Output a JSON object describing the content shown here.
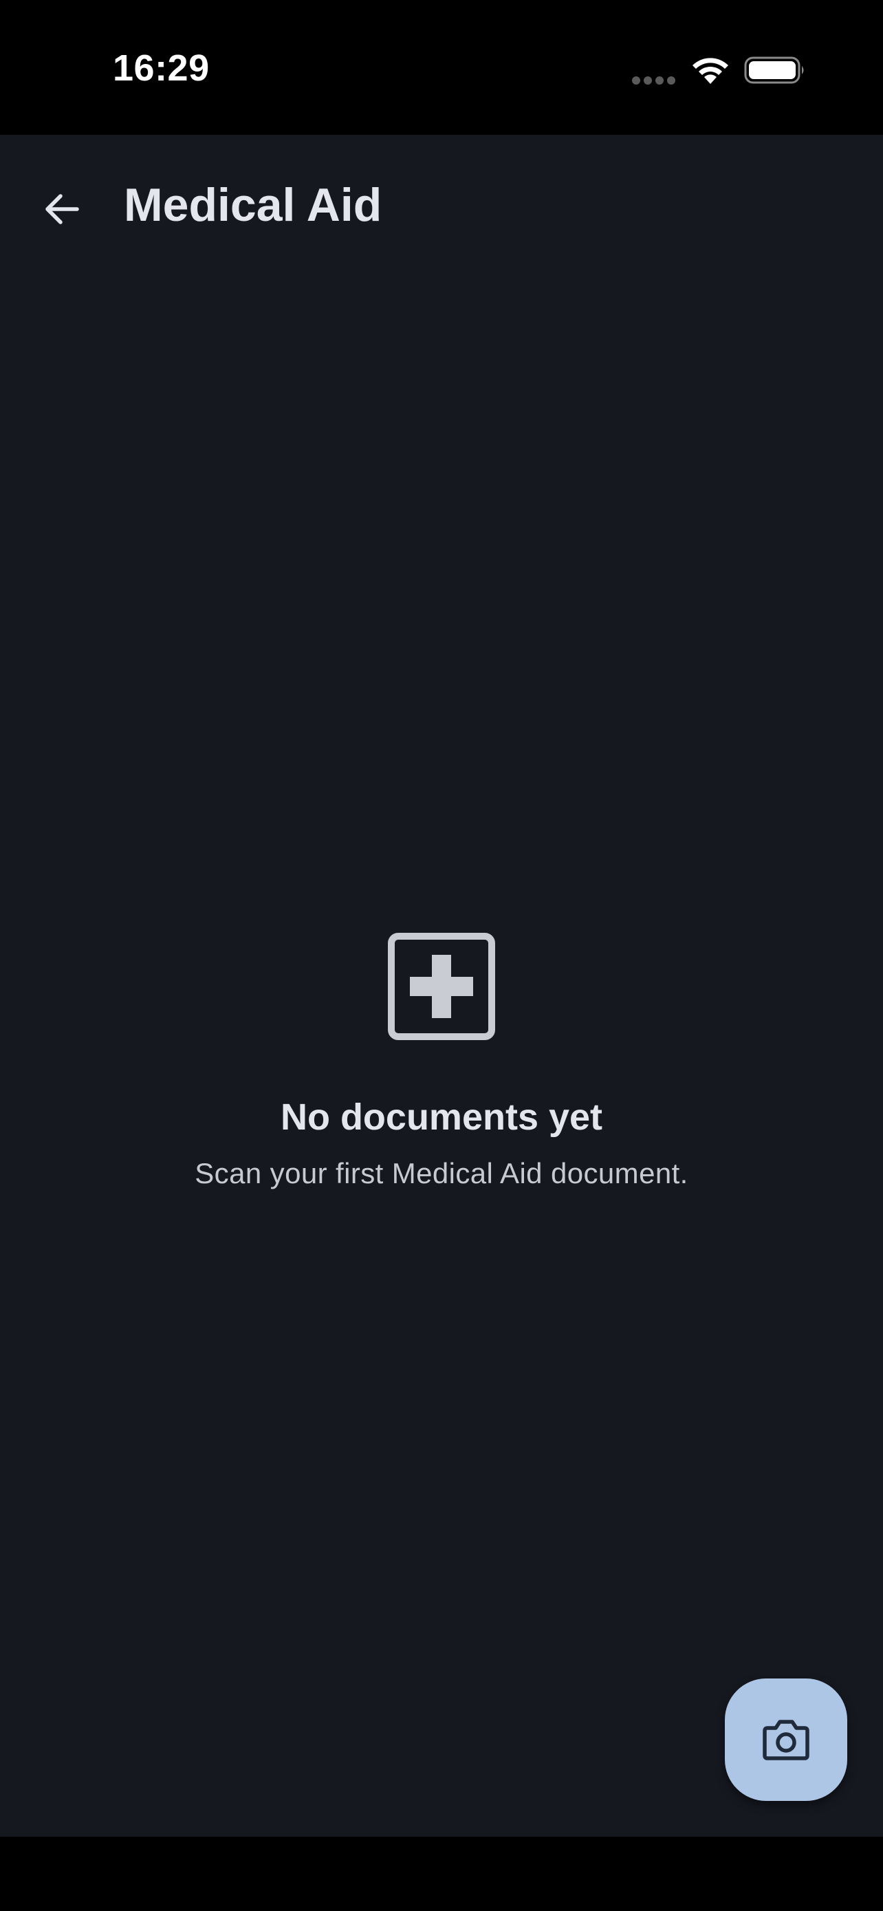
{
  "status_bar": {
    "time": "16:29",
    "icons": [
      "cellular-signal-icon",
      "wifi-icon",
      "battery-icon"
    ]
  },
  "header": {
    "back_icon": "arrow-left-icon",
    "title": "Medical Aid"
  },
  "empty_state": {
    "icon": "medical-cross-icon",
    "title": "No documents yet",
    "subtitle": "Scan your first Medical Aid document."
  },
  "fab": {
    "icon": "camera-icon"
  },
  "colors": {
    "background": "#161820",
    "text_primary": "#e4e6ec",
    "text_secondary": "#c7cad3",
    "icon_muted": "#c9ccd3",
    "fab_background": "#adc6e6",
    "fab_icon": "#1f2a3a"
  }
}
